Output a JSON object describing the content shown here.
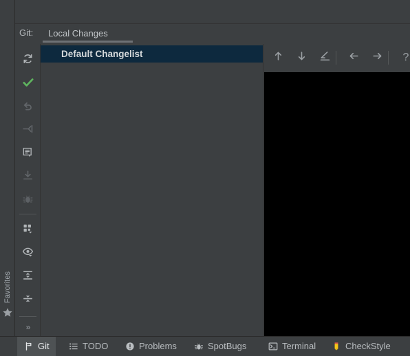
{
  "window": {
    "theme_bg": "#3c3f41",
    "selection_bg": "#0d293e",
    "accent_underline": "#6e7276"
  },
  "favorites_stripe": {
    "label": "Favorites",
    "icon": "star-icon"
  },
  "tab_header": {
    "caption": "Git:",
    "tabs": [
      {
        "label": "Local Changes",
        "selected": true
      }
    ]
  },
  "left_toolbar": {
    "buttons": [
      {
        "name": "refresh-button",
        "icon": "refresh-icon",
        "enabled": true
      },
      {
        "name": "commit-button",
        "icon": "checkmark-icon",
        "enabled": true
      },
      {
        "name": "rollback-button",
        "icon": "revert-arrow-icon",
        "enabled": false
      },
      {
        "name": "shelve-button",
        "icon": "shelve-arrow-icon",
        "enabled": false
      },
      {
        "name": "edit-changelist-button",
        "icon": "note-icon",
        "enabled": true
      },
      {
        "name": "get-from-shelf-button",
        "icon": "download-icon",
        "enabled": false
      },
      {
        "name": "debug-button",
        "icon": "bug-icon",
        "enabled": false
      },
      {
        "name": "group-by-button",
        "icon": "group-by-icon",
        "enabled": true
      },
      {
        "name": "preview-diff-button",
        "icon": "eye-icon",
        "enabled": true
      },
      {
        "name": "expand-all-button",
        "icon": "expand-all-icon",
        "enabled": true
      },
      {
        "name": "collapse-all-button",
        "icon": "collapse-all-icon",
        "enabled": true
      },
      {
        "name": "more-options-button",
        "icon": "chevron-double-right-icon",
        "label": "»",
        "enabled": true
      }
    ]
  },
  "changes_tree": {
    "nodes": [
      {
        "label": "Default Changelist",
        "selected": true,
        "bold": true
      }
    ]
  },
  "right_toolbar": {
    "buttons": [
      {
        "name": "previous-difference-button",
        "icon": "arrow-up-icon"
      },
      {
        "name": "next-difference-button",
        "icon": "arrow-down-icon"
      },
      {
        "name": "annotate-button",
        "icon": "pencil-icon"
      },
      {
        "name": "go-back-button",
        "icon": "arrow-left-icon"
      },
      {
        "name": "go-forward-button",
        "icon": "arrow-right-icon"
      },
      {
        "name": "help-button",
        "icon": "question-mark-icon",
        "label": "?"
      }
    ]
  },
  "bottom_bar": {
    "tabs": [
      {
        "label": "Git",
        "icon": "git-branch-icon",
        "active": true
      },
      {
        "label": "TODO",
        "icon": "todo-list-icon",
        "active": false
      },
      {
        "label": "Problems",
        "icon": "problems-icon",
        "active": false
      },
      {
        "label": "SpotBugs",
        "icon": "bug-icon",
        "active": false
      },
      {
        "label": "Terminal",
        "icon": "terminal-icon",
        "active": false
      },
      {
        "label": "CheckStyle",
        "icon": "pencil-yellow-icon",
        "active": false
      }
    ]
  }
}
